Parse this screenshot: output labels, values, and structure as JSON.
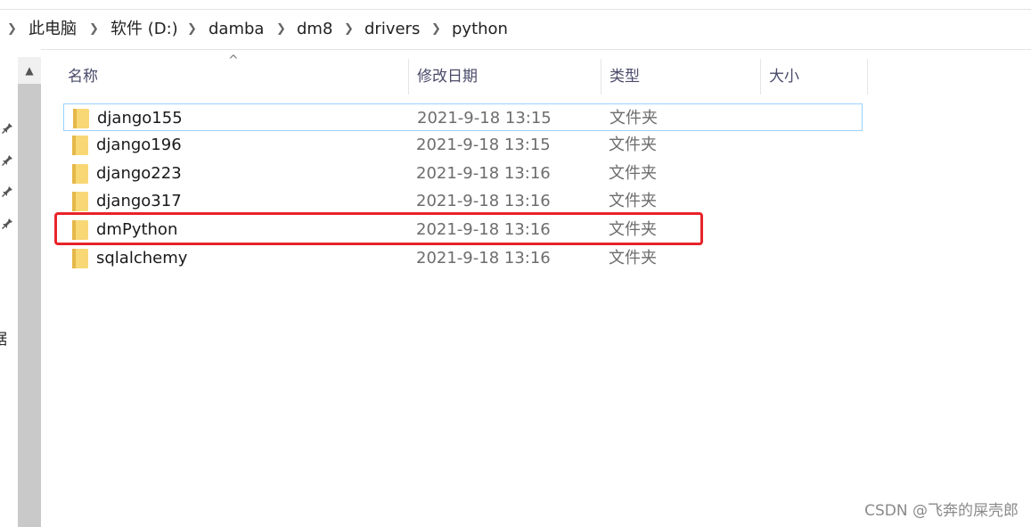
{
  "breadcrumb": {
    "items": [
      "此电脑",
      "软件 (D:)",
      "damba",
      "dm8",
      "drivers",
      "python"
    ]
  },
  "nav": {
    "partial_text": "据",
    "scroll_up": "▲"
  },
  "columns": {
    "name": "名称",
    "date": "修改日期",
    "type": "类型",
    "size": "大小",
    "sort_indicator": "^"
  },
  "files": [
    {
      "name": "django155",
      "date": "2021-9-18 13:15",
      "type": "文件夹",
      "size": ""
    },
    {
      "name": "django196",
      "date": "2021-9-18 13:15",
      "type": "文件夹",
      "size": ""
    },
    {
      "name": "django223",
      "date": "2021-9-18 13:16",
      "type": "文件夹",
      "size": ""
    },
    {
      "name": "django317",
      "date": "2021-9-18 13:16",
      "type": "文件夹",
      "size": ""
    },
    {
      "name": "dmPython",
      "date": "2021-9-18 13:16",
      "type": "文件夹",
      "size": ""
    },
    {
      "name": "sqlalchemy",
      "date": "2021-9-18 13:16",
      "type": "文件夹",
      "size": ""
    }
  ],
  "selected_index": 0,
  "highlighted_index": 4,
  "colors": {
    "folder": "#f8d775",
    "folder_dark": "#e6b84a",
    "selection_border": "#99d1ff",
    "highlight_border": "#e8232a"
  },
  "watermark": "CSDN @飞奔的屎壳郎"
}
